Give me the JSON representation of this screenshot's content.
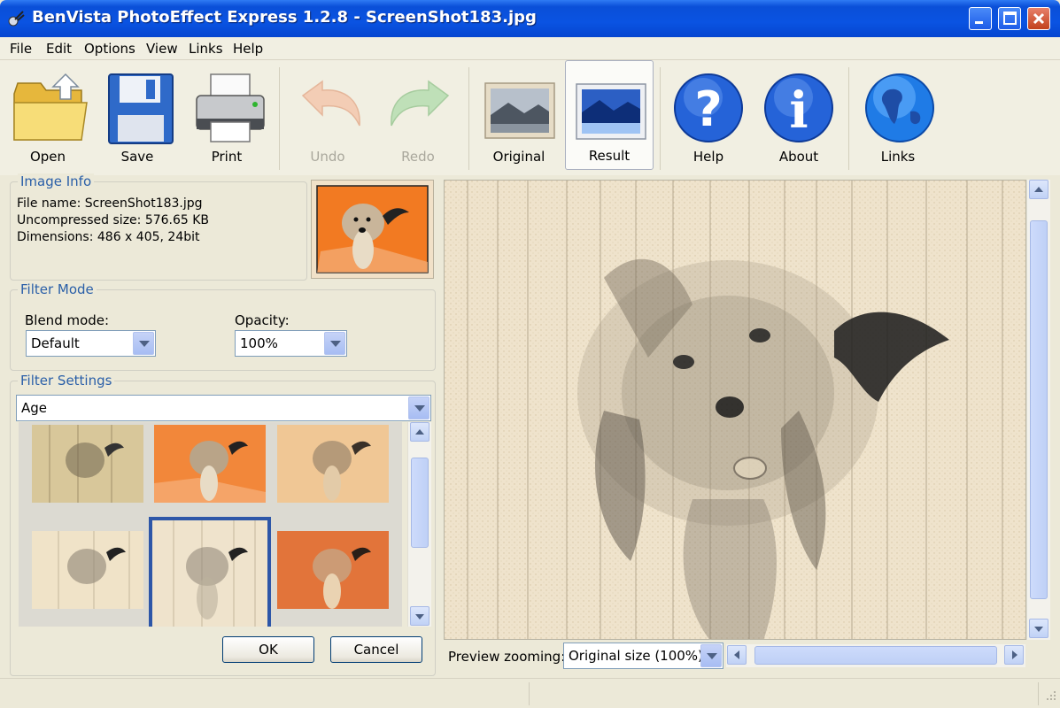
{
  "window": {
    "title": "BenVista PhotoEffect Express 1.2.8 - ScreenShot183.jpg"
  },
  "menu": [
    "File",
    "Edit",
    "Options",
    "View",
    "Links",
    "Help"
  ],
  "toolbar": {
    "open": "Open",
    "save": "Save",
    "print": "Print",
    "undo": "Undo",
    "redo": "Redo",
    "original": "Original",
    "result": "Result",
    "help": "Help",
    "about": "About",
    "links": "Links"
  },
  "image_info": {
    "title": "Image Info",
    "file_name": "File name: ScreenShot183.jpg",
    "uncompressed_size": "Uncompressed size: 576.65 KB",
    "dimensions": "Dimensions: 486 x 405, 24bit"
  },
  "filter_mode": {
    "title": "Filter Mode",
    "blend_label": "Blend mode:",
    "blend_value": "Default",
    "opacity_label": "Opacity:",
    "opacity_value": "100%"
  },
  "filter_settings": {
    "title": "Filter Settings",
    "filter_value": "Age",
    "ok": "OK",
    "cancel": "Cancel"
  },
  "preview": {
    "zoom_label": "Preview zooming:",
    "zoom_value": "Original size (100%)"
  },
  "colors": {
    "accent": "#0a53e2",
    "selection": "#2d56a8",
    "group_title": "#2a5fa8"
  }
}
